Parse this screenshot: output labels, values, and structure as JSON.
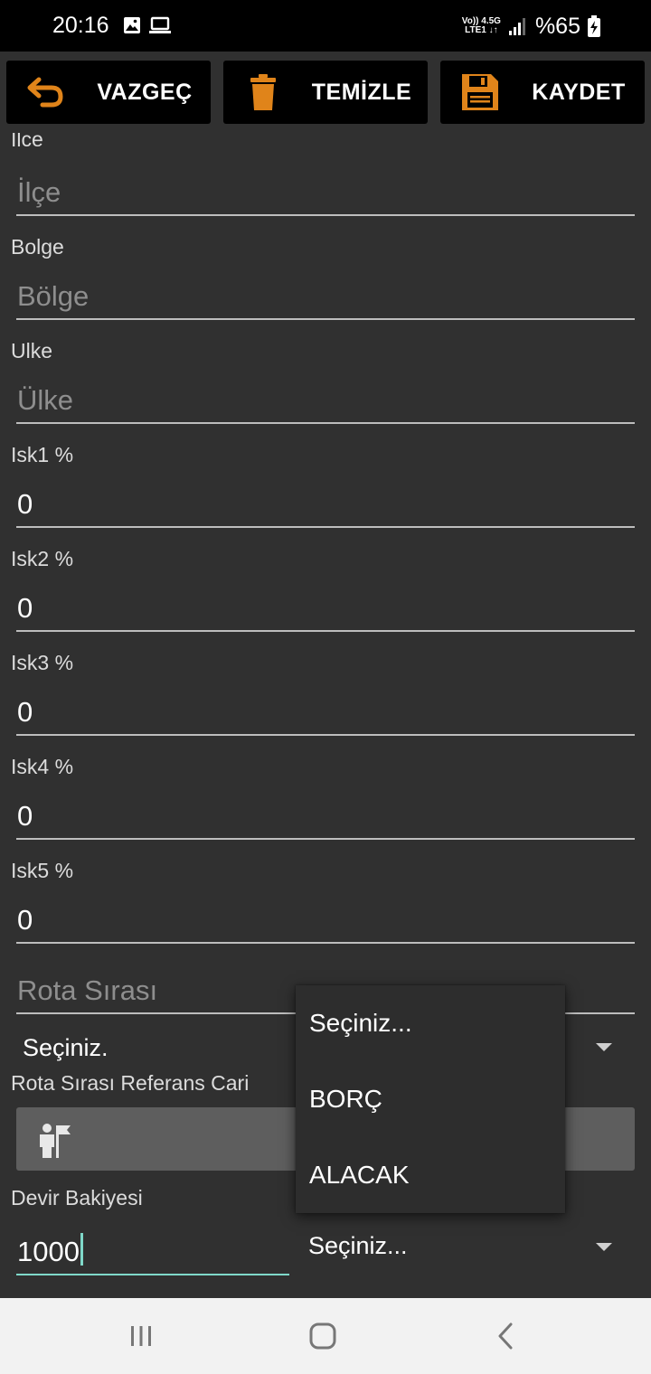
{
  "status_bar": {
    "time": "20:16",
    "network_top": "Vo)) 4.5G",
    "network_bottom": "LTE1 ↓↑",
    "battery": "%65",
    "icons": [
      "image-icon",
      "laptop-icon",
      "signal-icon",
      "battery-charging-icon"
    ]
  },
  "toolbar": {
    "cancel_label": "VAZGEÇ",
    "clear_label": "TEMİZLE",
    "save_label": "KAYDET",
    "accent_color": "#e0841a"
  },
  "form": {
    "ilce_label": "Ilce",
    "ilce_placeholder": "İlçe",
    "bolge_label": "Bolge",
    "bolge_placeholder": "Bölge",
    "ulke_label": "Ulke",
    "ulke_placeholder": "Ülke",
    "isk1_label": "Isk1 %",
    "isk1_value": "0",
    "isk2_label": "Isk2 %",
    "isk2_value": "0",
    "isk3_label": "Isk3 %",
    "isk3_value": "0",
    "isk4_label": "Isk4 %",
    "isk4_value": "0",
    "isk5_label": "Isk5 %",
    "isk5_value": "0",
    "rota_placeholder": "Rota Sırası",
    "rota_spinner_value": "Seçiniz.",
    "rota_ref_label": "Rota Sırası Referans Cari",
    "devir_label": "Devir Bakiyesi",
    "devir_value": "1000",
    "devir_type_value": "Seçiniz...",
    "focus_color": "#7fd8c9"
  },
  "dropdown": {
    "options": [
      "Seçiniz...",
      "BORÇ",
      "ALACAK"
    ]
  },
  "nav_bar": {
    "buttons": [
      "recent-apps",
      "home",
      "back"
    ]
  }
}
